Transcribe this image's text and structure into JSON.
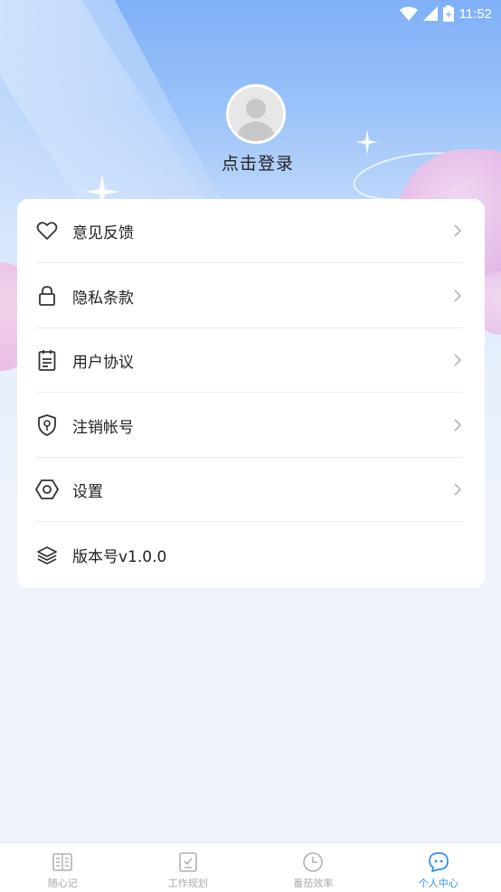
{
  "status_bar": {
    "time": "11:52",
    "wifi_icon": "wifi-icon",
    "signal_icon": "signal-icon",
    "battery_icon": "battery-icon"
  },
  "profile": {
    "avatar_icon": "user-avatar-icon",
    "login_label": "点击登录"
  },
  "menu": {
    "items": [
      {
        "label": "意见反馈",
        "icon": "heart-icon",
        "has_chevron": true
      },
      {
        "label": "隐私条款",
        "icon": "lock-icon",
        "has_chevron": true
      },
      {
        "label": "用户协议",
        "icon": "clipboard-icon",
        "has_chevron": true
      },
      {
        "label": "注销帐号",
        "icon": "shield-key-icon",
        "has_chevron": true
      },
      {
        "label": "设置",
        "icon": "hexagon-settings-icon",
        "has_chevron": true
      },
      {
        "label": "版本号v1.0.0",
        "icon": "layers-icon",
        "has_chevron": false
      }
    ]
  },
  "tabbar": {
    "active_color": "#2f8ef5",
    "inactive_color": "#a9a9a9",
    "tabs": [
      {
        "label": "随心记",
        "icon": "book-icon",
        "active": false
      },
      {
        "label": "工作规划",
        "icon": "checklist-icon",
        "active": false
      },
      {
        "label": "番茄效率",
        "icon": "clock-icon",
        "active": false
      },
      {
        "label": "个人中心",
        "icon": "chat-face-icon",
        "active": true
      }
    ]
  }
}
